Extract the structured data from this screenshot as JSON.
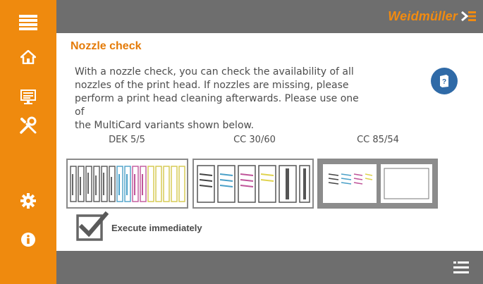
{
  "header": {
    "brand": "Weidmüller"
  },
  "sidebar": {
    "items": [
      {
        "icon": "hamburger-menu-icon"
      },
      {
        "icon": "home-icon"
      },
      {
        "icon": "monitor-icon"
      },
      {
        "icon": "tools-icon"
      },
      {
        "icon": "gear-icon"
      },
      {
        "icon": "info-icon"
      }
    ]
  },
  "page": {
    "title": "Nozzle check",
    "description_lines": [
      "With a nozzle check, you can check the availability of all",
      "nozzles of the print head. If nozzles are missing, please",
      "perform a print head cleaning afterwards. Please use one of",
      "the MultiCard variants shown below."
    ]
  },
  "cards": [
    {
      "label": "DEK 5/5"
    },
    {
      "label": "CC 30/60"
    },
    {
      "label": "CC 85/54"
    }
  ],
  "execute": {
    "label": "Execute immediately",
    "checked": true
  },
  "colors": {
    "accent": "#ef8a0e",
    "bar": "#6e6e6e",
    "help": "#2f6aa7"
  }
}
